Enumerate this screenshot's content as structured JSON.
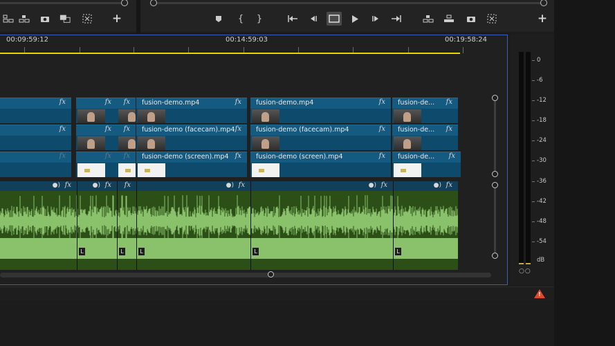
{
  "timecodes": [
    "00:09:59:12",
    "00:14:59:03",
    "00:19:58:24"
  ],
  "video_tracks": [
    {
      "clips": [
        {
          "name": "",
          "fx": "fx"
        },
        {
          "name": "",
          "fx": "fx"
        },
        {
          "name": "",
          "fx": "fx"
        },
        {
          "name": "fusion-demo.mp4",
          "fx": "fx"
        },
        {
          "name": "fusion-demo.mp4",
          "fx": "fx"
        },
        {
          "name": "fusion-de...",
          "fx": "fx"
        }
      ]
    },
    {
      "clips": [
        {
          "name": "",
          "fx": "fx"
        },
        {
          "name": "",
          "fx": "fx"
        },
        {
          "name": "",
          "fx": "fx"
        },
        {
          "name": "fusion-demo (facecam).mp4",
          "fx": "fx"
        },
        {
          "name": "fusion-demo (facecam).mp4",
          "fx": "fx"
        },
        {
          "name": "fusion-de...",
          "fx": "fx"
        }
      ]
    },
    {
      "clips": [
        {
          "name": "",
          "fx": "fx"
        },
        {
          "name": "",
          "fx": "fx"
        },
        {
          "name": "",
          "fx": "fx"
        },
        {
          "name": "fusion-demo (screen).mp4",
          "fx": "fx"
        },
        {
          "name": "fusion-demo (screen).mp4",
          "fx": "fx"
        },
        {
          "name": "fusion-de...",
          "fx": "fx"
        }
      ]
    }
  ],
  "audio_track": {
    "fx": "fx",
    "channel_label": "L"
  },
  "meter": {
    "scale": [
      "0",
      "-6",
      "-12",
      "-18",
      "-24",
      "-30",
      "-36",
      "-42",
      "-48",
      "-54",
      "dB"
    ],
    "solo_buttons": "○○"
  },
  "toolbar": {
    "program": {
      "add_label": "+",
      "mark_in": "{",
      "mark_out": "}"
    },
    "source": {
      "add_label": "+"
    }
  },
  "status": {
    "warning": "!"
  }
}
